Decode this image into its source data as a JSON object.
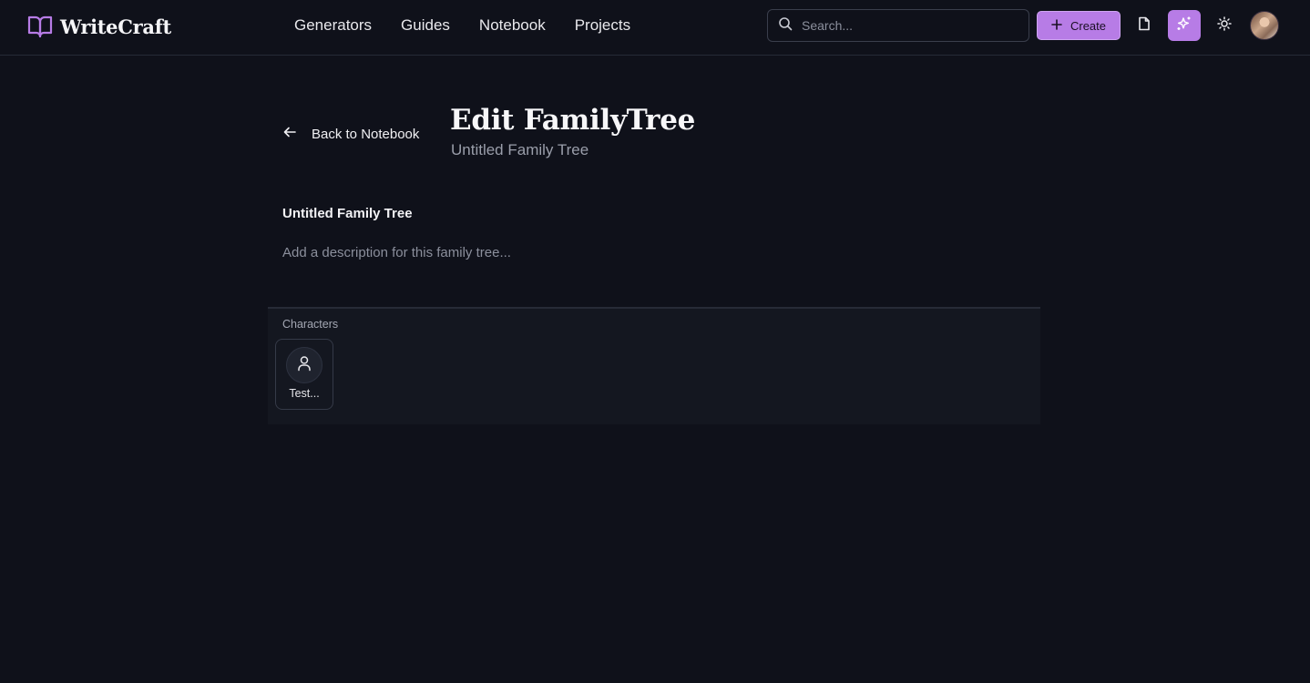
{
  "header": {
    "brand_name": "WriteCraft",
    "nav": [
      "Generators",
      "Guides",
      "Notebook",
      "Projects"
    ],
    "search_placeholder": "Search...",
    "create_label": "Create",
    "accent_color": "#b77ce6"
  },
  "page": {
    "back_label": "Back to Notebook",
    "title": "Edit FamilyTree",
    "subtitle": "Untitled Family Tree",
    "tree_name": "Untitled Family Tree",
    "description_placeholder": "Add a description for this family tree..."
  },
  "characters": {
    "label": "Characters",
    "items": [
      {
        "name": "Test...",
        "icon": "user-icon"
      }
    ]
  }
}
